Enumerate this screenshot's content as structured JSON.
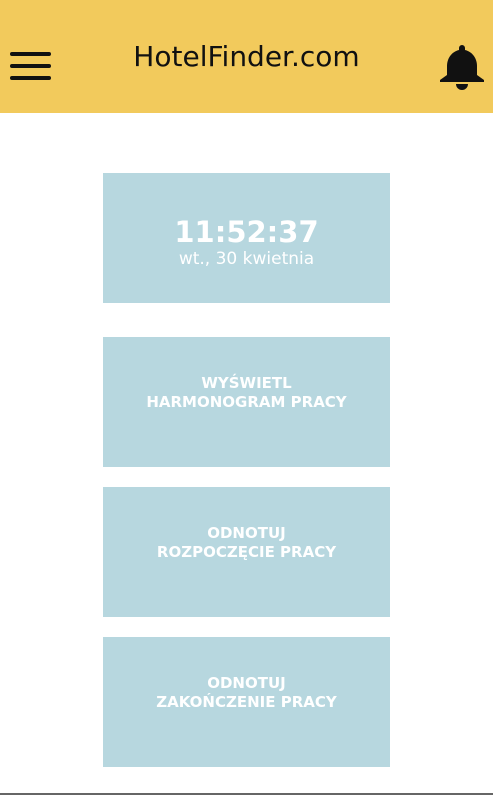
{
  "header": {
    "title": "HotelFinder.com",
    "menu_icon": "hamburger-menu-icon",
    "notification_icon": "bell-icon",
    "background": "#f2ca5c"
  },
  "clock": {
    "time": "11:52:37",
    "date": "wt., 30 kwietnia"
  },
  "actions": {
    "schedule": {
      "line1": "WYŚWIETL",
      "line2": "HARMONOGRAM PRACY"
    },
    "start_work": {
      "line1": "ODNOTUJ",
      "line2": "ROZPOCZĘCIE PRACY"
    },
    "end_work": {
      "line1": "ODNOTUJ",
      "line2": "ZAKOŃCZENIE PRACY"
    }
  },
  "colors": {
    "card_background": "#b7d7df",
    "card_text": "#ffffff"
  }
}
